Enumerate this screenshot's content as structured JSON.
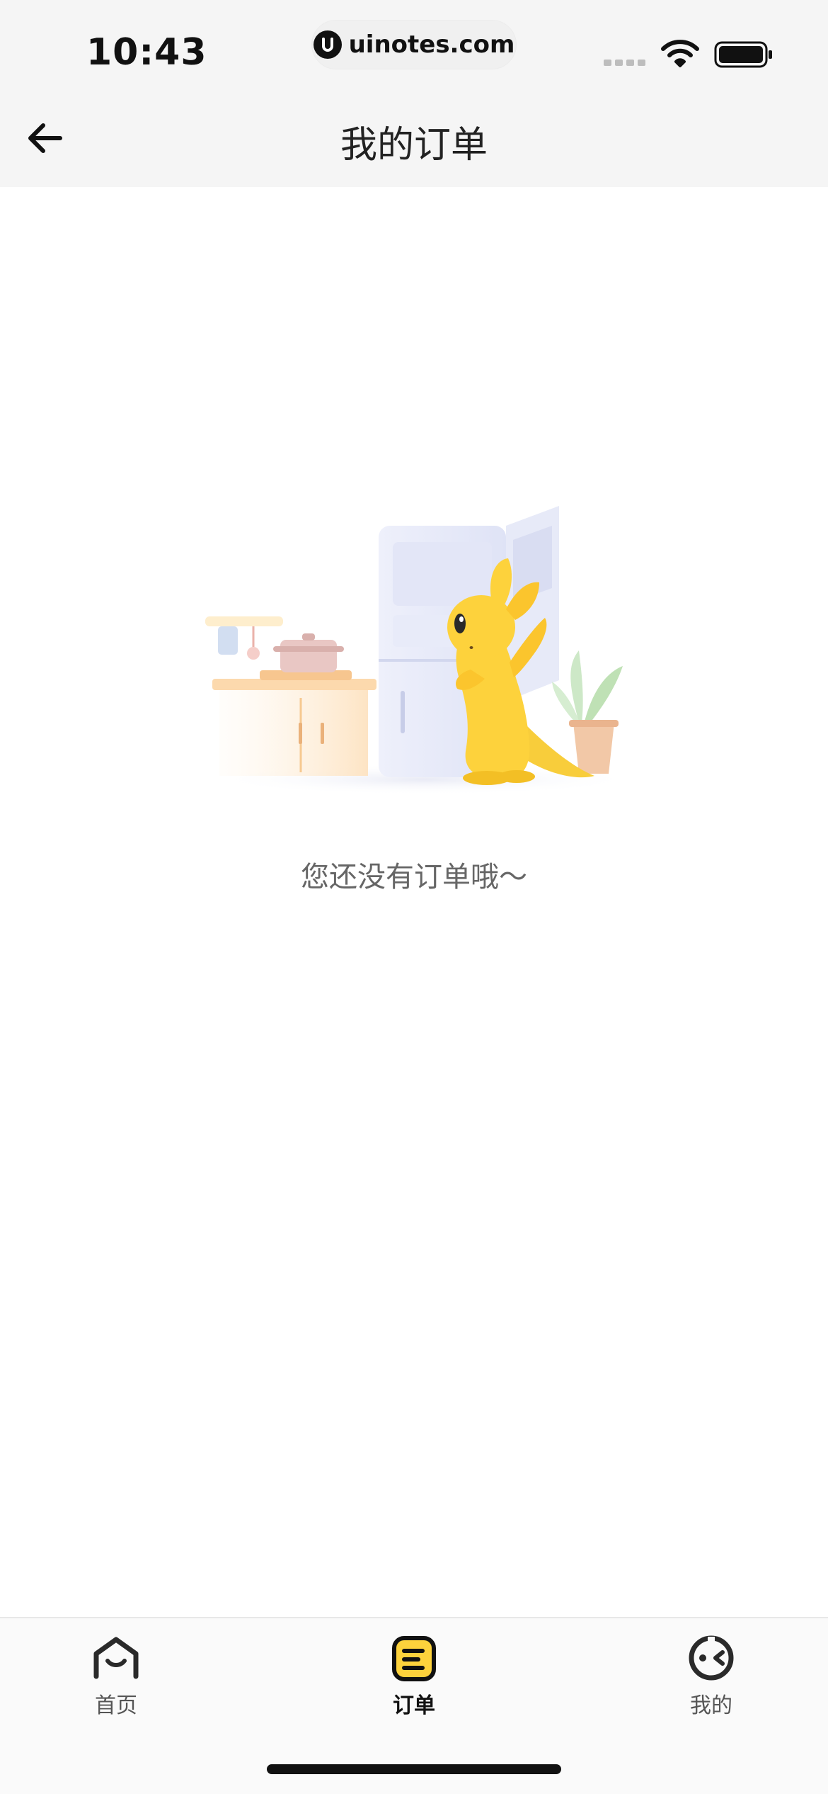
{
  "status_bar": {
    "time": "10:43",
    "url": "uinotes.com",
    "icons": [
      "signal-icon",
      "wifi-icon",
      "battery-icon"
    ]
  },
  "header": {
    "title": "我的订单",
    "back_icon": "arrow-left-icon"
  },
  "empty_state": {
    "message": "您还没有订单哦～",
    "illustration": "kangaroo-fridge-illustration"
  },
  "tab_bar": {
    "tabs": [
      {
        "label": "首页",
        "icon": "home-icon",
        "active": false
      },
      {
        "label": "订单",
        "icon": "order-icon",
        "active": true
      },
      {
        "label": "我的",
        "icon": "profile-icon",
        "active": false
      }
    ]
  },
  "colors": {
    "accent": "#fdd23c",
    "header_bg": "#f5f5f5",
    "text_primary": "#222222",
    "text_secondary": "#666666"
  }
}
